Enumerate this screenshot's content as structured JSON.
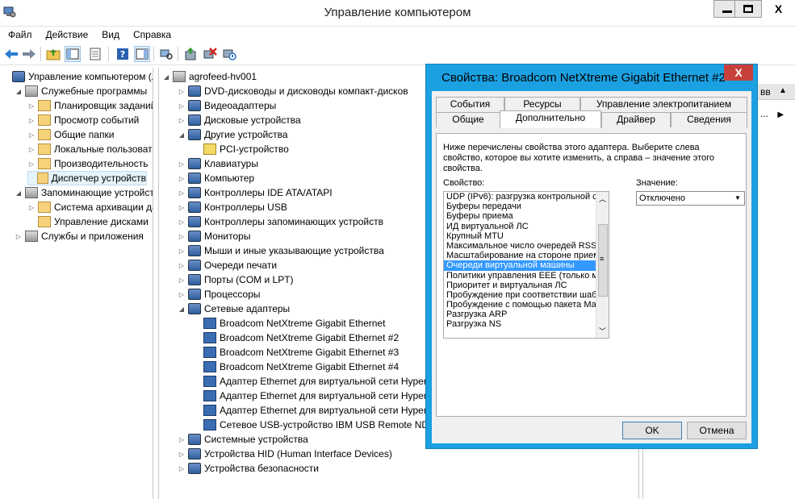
{
  "window": {
    "title": "Управление компьютером",
    "controls": {
      "minimize": "—",
      "maximize": "☐",
      "close": "X"
    }
  },
  "menu": [
    "Файл",
    "Действие",
    "Вид",
    "Справка"
  ],
  "left_tree": [
    {
      "label": "Управление компьютером (л",
      "level": 0,
      "arrow": ""
    },
    {
      "label": "Служебные программы",
      "level": 1,
      "arrow": "◢"
    },
    {
      "label": "Планировщик заданий",
      "level": 2,
      "arrow": "▷"
    },
    {
      "label": "Просмотр событий",
      "level": 2,
      "arrow": "▷"
    },
    {
      "label": "Общие папки",
      "level": 2,
      "arrow": "▷"
    },
    {
      "label": "Локальные пользовате",
      "level": 2,
      "arrow": "▷"
    },
    {
      "label": "Производительность",
      "level": 2,
      "arrow": "▷"
    },
    {
      "label": "Диспетчер устройств",
      "level": 2,
      "arrow": "",
      "selected": true
    },
    {
      "label": "Запоминающие устройст",
      "level": 1,
      "arrow": "◢"
    },
    {
      "label": "Система архивации да",
      "level": 2,
      "arrow": "▷"
    },
    {
      "label": "Управление дисками",
      "level": 2,
      "arrow": ""
    },
    {
      "label": "Службы и приложения",
      "level": 1,
      "arrow": "▷"
    }
  ],
  "device_tree": [
    {
      "label": "agrofeed-hv001",
      "level": 0,
      "arrow": "◢"
    },
    {
      "label": "DVD-дисководы и дисководы компакт-дисков",
      "level": 1,
      "arrow": "▷"
    },
    {
      "label": "Видеоадаптеры",
      "level": 1,
      "arrow": "▷"
    },
    {
      "label": "Дисковые устройства",
      "level": 1,
      "arrow": "▷"
    },
    {
      "label": "Другие устройства",
      "level": 1,
      "arrow": "◢"
    },
    {
      "label": "PCI-устройство",
      "level": 2,
      "arrow": "",
      "warn": true
    },
    {
      "label": "Клавиатуры",
      "level": 1,
      "arrow": "▷"
    },
    {
      "label": "Компьютер",
      "level": 1,
      "arrow": "▷"
    },
    {
      "label": "Контроллеры IDE ATA/ATAPI",
      "level": 1,
      "arrow": "▷"
    },
    {
      "label": "Контроллеры USB",
      "level": 1,
      "arrow": "▷"
    },
    {
      "label": "Контроллеры запоминающих устройств",
      "level": 1,
      "arrow": "▷"
    },
    {
      "label": "Мониторы",
      "level": 1,
      "arrow": "▷"
    },
    {
      "label": "Мыши и иные указывающие устройства",
      "level": 1,
      "arrow": "▷"
    },
    {
      "label": "Очереди печати",
      "level": 1,
      "arrow": "▷"
    },
    {
      "label": "Порты (COM и LPT)",
      "level": 1,
      "arrow": "▷"
    },
    {
      "label": "Процессоры",
      "level": 1,
      "arrow": "▷"
    },
    {
      "label": "Сетевые адаптеры",
      "level": 1,
      "arrow": "◢"
    },
    {
      "label": "Broadcom NetXtreme Gigabit Ethernet",
      "level": 2,
      "arrow": "",
      "net": true
    },
    {
      "label": "Broadcom NetXtreme Gigabit Ethernet #2",
      "level": 2,
      "arrow": "",
      "net": true
    },
    {
      "label": "Broadcom NetXtreme Gigabit Ethernet #3",
      "level": 2,
      "arrow": "",
      "net": true
    },
    {
      "label": "Broadcom NetXtreme Gigabit Ethernet #4",
      "level": 2,
      "arrow": "",
      "net": true
    },
    {
      "label": "Адаптер Ethernet для виртуальной сети Hyper",
      "level": 2,
      "arrow": "",
      "net": true
    },
    {
      "label": "Адаптер Ethernet для виртуальной сети Hyper",
      "level": 2,
      "arrow": "",
      "net": true
    },
    {
      "label": "Адаптер Ethernet для виртуальной сети Hyper",
      "level": 2,
      "arrow": "",
      "net": true
    },
    {
      "label": "Сетевое USB-устройство IBM USB Remote NDI",
      "level": 2,
      "arrow": "",
      "net": true
    },
    {
      "label": "Системные устройства",
      "level": 1,
      "arrow": "▷"
    },
    {
      "label": "Устройства HID (Human Interface Devices)",
      "level": 1,
      "arrow": "▷"
    },
    {
      "label": "Устройства безопасности",
      "level": 1,
      "arrow": "▷"
    }
  ],
  "right_pane": {
    "header_fragment": "вв",
    "item_fragment": "..."
  },
  "dialog": {
    "title": "Свойства: Broadcom NetXtreme Gigabit Ethernet #2",
    "close": "X",
    "tabs_row1": [
      "События",
      "Ресурсы",
      "Управление электропитанием"
    ],
    "tabs_row2": [
      "Общие",
      "Дополнительно",
      "Драйвер",
      "Сведения"
    ],
    "active_tab": "Дополнительно",
    "description": "Ниже перечислены свойства этого адаптера. Выберите слева свойство, которое вы хотите изменить, а справа – значение этого свойства.",
    "property_label": "Свойство:",
    "value_label": "Значение:",
    "properties": [
      "UDP (IPv6): разгрузка контрольной с",
      "Буферы передачи",
      "Буферы приема",
      "ИД виртуальной ЛС",
      "Крупный MTU",
      "Максимальное число очередей RSS",
      "Масштабирование на стороне прием",
      "Очереди виртуальной машины",
      "Политики управления EEE (только м",
      "Приоритет и виртуальная ЛС",
      "Пробуждение при соответствии шаб",
      "Пробуждение с помощью пакета Ма",
      "Разгрузка ARP",
      "Разгрузка NS"
    ],
    "selected_property": "Очереди виртуальной машины",
    "value": "Отключено",
    "ok": "OK",
    "cancel": "Отмена"
  }
}
